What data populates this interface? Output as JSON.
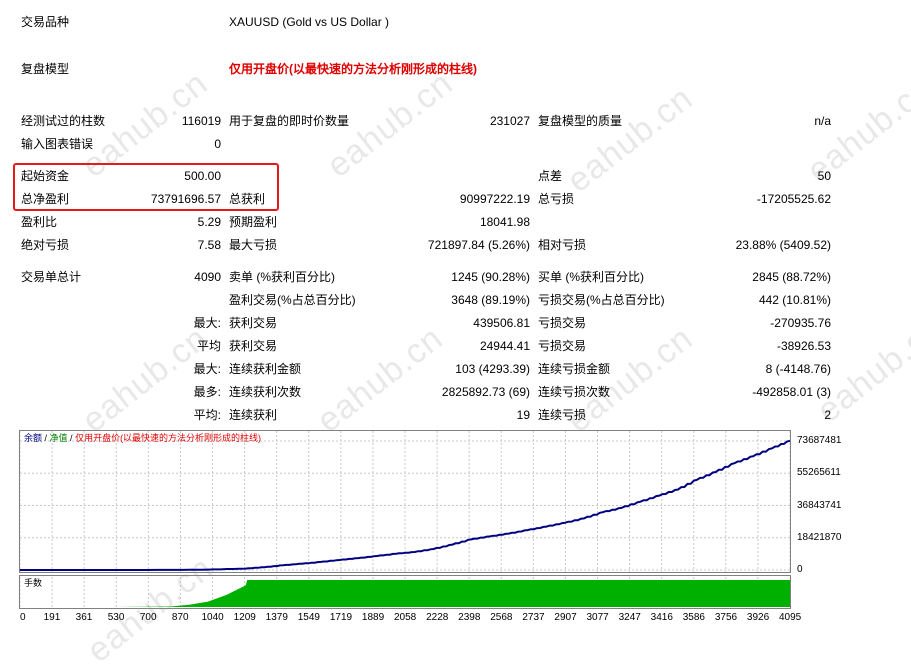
{
  "header": {
    "symbol_label": "交易品种",
    "symbol_value": "XAUUSD (Gold vs US Dollar )",
    "model_label": "复盘模型",
    "model_value": "仅用开盘价(以最快速的方法分析刚形成的柱线)"
  },
  "stats": {
    "bars_label": "经测试过的柱数",
    "bars_value": "116019",
    "ticks_label": "用于复盘的即时价数量",
    "ticks_value": "231027",
    "quality_label": "复盘模型的质量",
    "quality_value": "n/a",
    "errors_label": "输入图表错误",
    "errors_value": "0",
    "deposit_label": "起始资金",
    "deposit_value": "500.00",
    "spread_label": "点差",
    "spread_value": "50",
    "net_profit_label": "总净盈利",
    "net_profit_value": "73791696.57",
    "gross_profit_label": "总获利",
    "gross_profit_value": "90997222.19",
    "gross_loss_label": "总亏损",
    "gross_loss_value": "-17205525.62",
    "profit_factor_label": "盈利比",
    "profit_factor_value": "5.29",
    "expected_payoff_label": "预期盈利",
    "expected_payoff_value": "18041.98",
    "abs_drawdown_label": "绝对亏损",
    "abs_drawdown_value": "7.58",
    "max_drawdown_label": "最大亏损",
    "max_drawdown_value": "721897.84 (5.26%)",
    "rel_drawdown_label": "相对亏损",
    "rel_drawdown_value": "23.88% (5409.52)",
    "total_trades_label": "交易单总计",
    "total_trades_value": "4090",
    "short_label": "卖单 (%获利百分比)",
    "short_value": "1245 (90.28%)",
    "long_label": "买单 (%获利百分比)",
    "long_value": "2845 (88.72%)",
    "profit_trades_label": "盈利交易(%占总百分比)",
    "profit_trades_value": "3648 (89.19%)",
    "loss_trades_label": "亏损交易(%占总百分比)",
    "loss_trades_value": "442 (10.81%)",
    "largest_prefix": "最大:",
    "largest_profit_label": "获利交易",
    "largest_profit_value": "439506.81",
    "largest_loss_label": "亏损交易",
    "largest_loss_value": "-270935.76",
    "average_prefix": "平均",
    "average_profit_label": "获利交易",
    "average_profit_value": "24944.41",
    "average_loss_label": "亏损交易",
    "average_loss_value": "-38926.53",
    "max_prefix": "最大:",
    "max_consec_wins_label": "连续获利金额",
    "max_consec_wins_value": "103 (4293.39)",
    "max_consec_losses_label": "连续亏损金额",
    "max_consec_losses_value": "8 (-4148.76)",
    "most_prefix": "最多:",
    "most_consec_profit_label": "连续获利次数",
    "most_consec_profit_value": "2825892.73 (69)",
    "most_consec_loss_label": "连续亏损次数",
    "most_consec_loss_value": "-492858.01 (3)",
    "avg_prefix": "平均:",
    "avg_consec_wins_label": "连续获利",
    "avg_consec_wins_value": "19",
    "avg_consec_losses_label": "连续亏损",
    "avg_consec_losses_value": "2"
  },
  "chart_legend": {
    "balance": "余额",
    "sep1": " / ",
    "equity": "净值",
    "sep2": " / ",
    "model": "仅用开盘价(以最快速的方法分析刚形成的柱线)"
  },
  "volume_label": "手数",
  "watermark": "eahub.cn",
  "colors": {
    "balance_line": "#000080",
    "volume_fill": "#00b000",
    "highlight_box": "#e8191c",
    "model_text": "#e00000"
  },
  "chart_data": {
    "type": "line",
    "y_ticks": [
      "73687481",
      "55265611",
      "36843741",
      "18421870",
      "0"
    ],
    "y_tick_values": [
      73687481,
      55265611,
      36843741,
      18421870,
      0
    ],
    "ylim": [
      0,
      73687481
    ],
    "x_ticks": [
      "0",
      "191",
      "361",
      "530",
      "700",
      "870",
      "1040",
      "1209",
      "1379",
      "1549",
      "1719",
      "1889",
      "2058",
      "2228",
      "2398",
      "2568",
      "2737",
      "2907",
      "3077",
      "3247",
      "3416",
      "3586",
      "3756",
      "3926",
      "4095"
    ],
    "xlim": [
      0,
      4095
    ],
    "balance": {
      "x": [
        0,
        400,
        800,
        1000,
        1200,
        1300,
        1400,
        1500,
        1600,
        1700,
        1800,
        1900,
        2000,
        2100,
        2200,
        2300,
        2400,
        2500,
        2600,
        2700,
        2800,
        2900,
        3000,
        3100,
        3200,
        3300,
        3400,
        3500,
        3600,
        3700,
        3800,
        3900,
        4000,
        4095
      ],
      "y": [
        500,
        2000,
        40000,
        200000,
        800000,
        1600000,
        2700000,
        3600000,
        4600000,
        5700000,
        6800000,
        8000000,
        9300000,
        10300000,
        12000000,
        14500000,
        17500000,
        19200000,
        20800000,
        22800000,
        24800000,
        27000000,
        29500000,
        33000000,
        35500000,
        39000000,
        42500000,
        46000000,
        51500000,
        56000000,
        61000000,
        65000000,
        69500000,
        73791696
      ]
    },
    "volume": {
      "x": [
        0,
        500,
        800,
        900,
        1000,
        1100,
        1200,
        1209,
        4095
      ],
      "level": [
        0,
        0,
        0.02,
        0.08,
        0.2,
        0.45,
        0.8,
        1,
        1
      ]
    }
  }
}
